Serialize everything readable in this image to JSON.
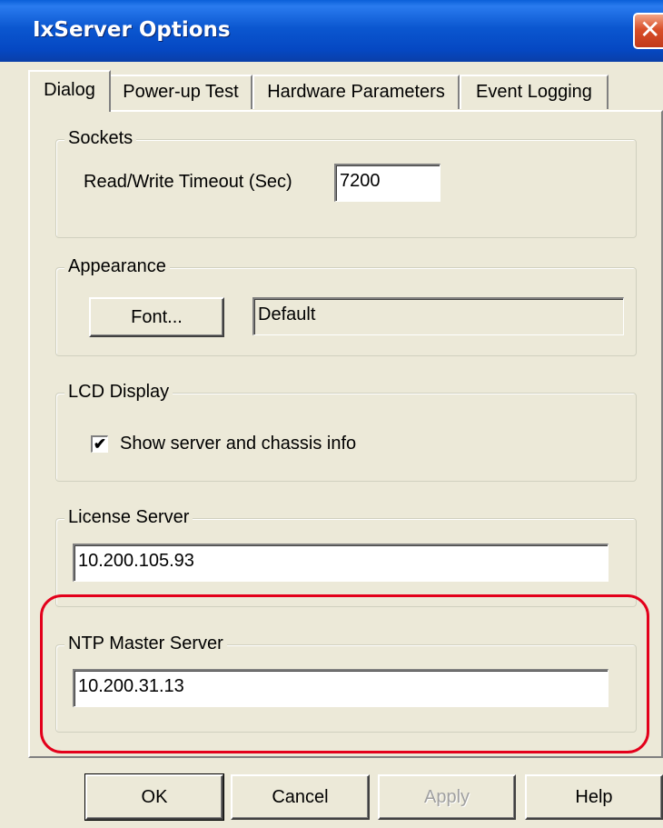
{
  "window": {
    "title": "IxServer Options",
    "close_glyph": "✕"
  },
  "tabs": [
    {
      "label": "Dialog",
      "active": true
    },
    {
      "label": "Power-up Test",
      "active": false
    },
    {
      "label": "Hardware Parameters",
      "active": false
    },
    {
      "label": "Event Logging",
      "active": false
    }
  ],
  "groups": {
    "sockets": {
      "legend": "Sockets",
      "timeout_label": "Read/Write Timeout (Sec)",
      "timeout_value": "7200"
    },
    "appearance": {
      "legend": "Appearance",
      "font_button": "Font...",
      "font_value": "Default"
    },
    "lcd": {
      "legend": "LCD Display",
      "checkbox_label": "Show server and chassis info",
      "checked": true,
      "check_glyph": "✔"
    },
    "license": {
      "legend": "License Server",
      "value": "10.200.105.93"
    },
    "ntp": {
      "legend": "NTP Master Server",
      "value": "10.200.31.13"
    }
  },
  "buttons": {
    "ok": "OK",
    "cancel": "Cancel",
    "apply": "Apply",
    "help": "Help"
  },
  "colors": {
    "highlight": "#E3001B",
    "titlebar": "#0B57D0"
  }
}
